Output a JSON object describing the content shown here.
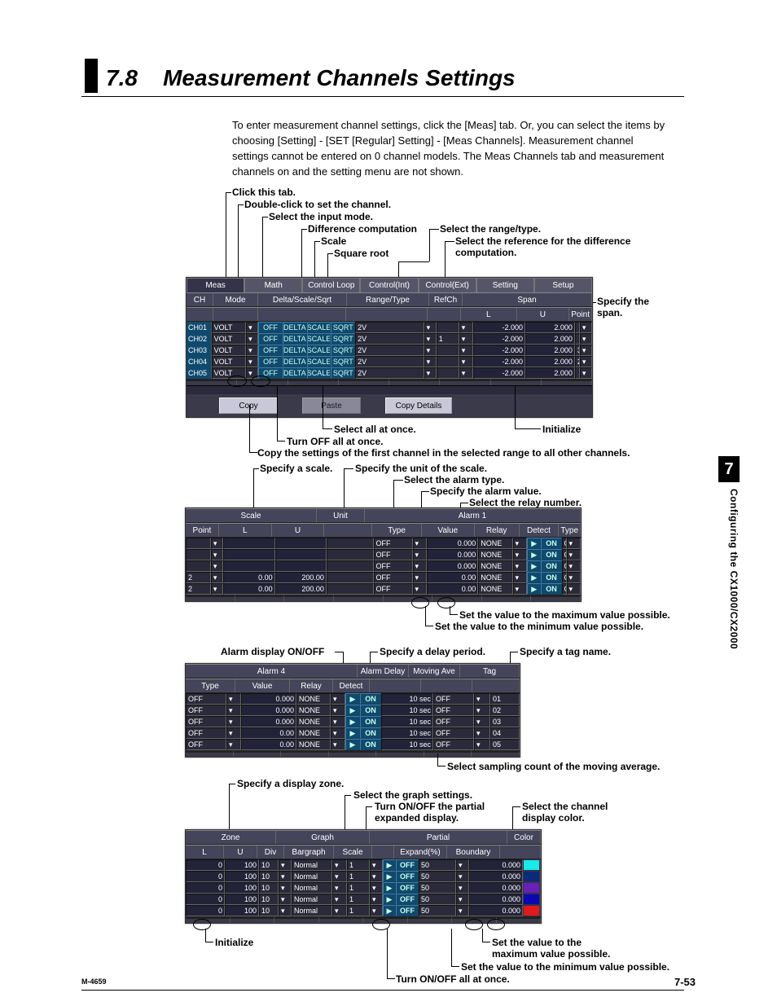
{
  "section_number": "7.8",
  "section_title": "Measurement Channels Settings",
  "intro": "To enter measurement channel settings, click the [Meas] tab.  Or, you can select the items by choosing [Setting] - [SET [Regular] Setting] - [Meas Channels].  Measurement channel settings cannot be entered on 0 channel models. The Meas Channels tab and measurement channels on and the setting menu are not shown.",
  "callouts": {
    "click_tab": "Click this tab.",
    "double_click": "Double-click to set the channel.",
    "input_mode": "Select the input mode.",
    "diff_comp": "Difference computation",
    "scale": "Scale",
    "sqrt": "Square root",
    "range_type": "Select the range/type.",
    "ref_diff": "Select the reference for the difference computation.",
    "specify_span": "Specify the span.",
    "select_all": "Select all at once.",
    "turn_off_all": "Turn OFF all at once.",
    "initialize": "Initialize",
    "copy_first": "Copy the settings of the first channel in the selected range to all other channels.",
    "specify_scale": "Specify a scale.",
    "specify_unit": "Specify the unit of the scale.",
    "alarm_type": "Select the alarm type.",
    "alarm_value": "Specify the alarm value.",
    "relay_number": "Select the relay number.",
    "set_max": "Set the value to the maximum value possible.",
    "set_min": "Set the value to the minimum value possible.",
    "alarm_display": "Alarm display ON/OFF",
    "delay_period": "Specify a delay period.",
    "tag_name": "Specify a tag name.",
    "moving_avg": "Select sampling count of the moving average.",
    "display_zone": "Specify a display zone.",
    "graph_settings": "Select the graph settings.",
    "partial_onoff": "Turn ON/OFF the partial expanded display.",
    "channel_color": "Select the channel display color.",
    "set_max2": "Set the value to the maximum value possible.",
    "set_min2": "Set the value to the minimum value possible.",
    "onoff_all": "Turn ON/OFF all at once.",
    "initialize2": "Initialize"
  },
  "shot1": {
    "tabs": [
      "Meas",
      "Math",
      "Control Loop",
      "Control(Int)",
      "Control(Ext)",
      "Setting",
      "Setup"
    ],
    "hdr_top": [
      "CH",
      "Mode",
      "Delta/Scale/Sqrt",
      "Range/Type",
      "RefCh",
      "Span"
    ],
    "hdr_span": [
      "L",
      "U",
      "Point"
    ],
    "rows": [
      {
        "ch": "CH01",
        "mode": "VOLT",
        "delta": "OFF",
        "d2": "DELTA",
        "d3": "SCALE",
        "d4": "SQRT",
        "range": "2V",
        "ref": "",
        "l": "-2.000",
        "u": "2.000",
        "pt": ""
      },
      {
        "ch": "CH02",
        "mode": "VOLT",
        "delta": "OFF",
        "d2": "DELTA",
        "d3": "SCALE",
        "d4": "SQRT",
        "range": "2V",
        "ref": "1",
        "l": "-2.000",
        "u": "2.000",
        "pt": ""
      },
      {
        "ch": "CH03",
        "mode": "VOLT",
        "delta": "OFF",
        "d2": "DELTA",
        "d3": "SCALE",
        "d4": "SQRT",
        "range": "2V",
        "ref": "",
        "l": "-2.000",
        "u": "2.000",
        "pt": "3"
      },
      {
        "ch": "CH04",
        "mode": "VOLT",
        "delta": "OFF",
        "d2": "DELTA",
        "d3": "SCALE",
        "d4": "SQRT",
        "range": "2V",
        "ref": "",
        "l": "-2.000",
        "u": "2.000",
        "pt": "2"
      },
      {
        "ch": "CH05",
        "mode": "VOLT",
        "delta": "OFF",
        "d2": "DELTA",
        "d3": "SCALE",
        "d4": "SQRT",
        "range": "2V",
        "ref": "",
        "l": "-2.000",
        "u": "2.000",
        "pt": ""
      }
    ],
    "buttons": [
      "Copy",
      "Paste",
      "Copy Details"
    ]
  },
  "shot2": {
    "hdr_groups": [
      "Scale",
      "Unit",
      "Alarm 1"
    ],
    "hdr": [
      "Point",
      "L",
      "U",
      "",
      "Type",
      "Value",
      "Relay",
      "Detect",
      "Type"
    ],
    "rows": [
      {
        "pt": "",
        "l": "",
        "u": "",
        "unit": "",
        "atype": "OFF",
        "val": "0.000",
        "relay": "NONE",
        "det": "ON",
        "t2": "OFF"
      },
      {
        "pt": "",
        "l": "",
        "u": "",
        "unit": "",
        "atype": "OFF",
        "val": "0.000",
        "relay": "NONE",
        "det": "ON",
        "t2": "OFF"
      },
      {
        "pt": "",
        "l": "",
        "u": "",
        "unit": "",
        "atype": "OFF",
        "val": "0.000",
        "relay": "NONE",
        "det": "ON",
        "t2": "OFF"
      },
      {
        "pt": "2",
        "l": "0.00",
        "u": "200.00",
        "unit": "",
        "atype": "OFF",
        "val": "0.00",
        "relay": "NONE",
        "det": "ON",
        "t2": "OFF"
      },
      {
        "pt": "2",
        "l": "0.00",
        "u": "200.00",
        "unit": "",
        "atype": "OFF",
        "val": "0.00",
        "relay": "NONE",
        "det": "ON",
        "t2": "OFF"
      }
    ]
  },
  "shot3": {
    "hdr_groups": [
      "Alarm 4",
      "Alarm Delay",
      "Moving Ave",
      "Tag"
    ],
    "hdr": [
      "Type",
      "Value",
      "Relay",
      "Detect",
      "",
      "",
      "",
      ""
    ],
    "rows": [
      {
        "type": "OFF",
        "val": "0.000",
        "relay": "NONE",
        "det": "ON",
        "delay": "10 sec",
        "mave": "OFF",
        "tag": "01"
      },
      {
        "type": "OFF",
        "val": "0.000",
        "relay": "NONE",
        "det": "ON",
        "delay": "10 sec",
        "mave": "OFF",
        "tag": "02"
      },
      {
        "type": "OFF",
        "val": "0.000",
        "relay": "NONE",
        "det": "ON",
        "delay": "10 sec",
        "mave": "OFF",
        "tag": "03"
      },
      {
        "type": "OFF",
        "val": "0.00",
        "relay": "NONE",
        "det": "ON",
        "delay": "10 sec",
        "mave": "OFF",
        "tag": "04"
      },
      {
        "type": "OFF",
        "val": "0.00",
        "relay": "NONE",
        "det": "ON",
        "delay": "10 sec",
        "mave": "OFF",
        "tag": "05"
      }
    ]
  },
  "shot4": {
    "hdr_groups": [
      "Zone",
      "Graph",
      "Partial",
      "Color"
    ],
    "hdr": [
      "L",
      "U",
      "Div",
      "Bargraph",
      "Scale",
      "",
      "Expand(%)",
      "Boundary",
      ""
    ],
    "rows": [
      {
        "l": "0",
        "u": "100",
        "div": "10",
        "bg": "Normal",
        "sc": "1",
        "on": "OFF",
        "exp": "50",
        "bnd": "0.000",
        "clr": "#18e9e9"
      },
      {
        "l": "0",
        "u": "100",
        "div": "10",
        "bg": "Normal",
        "sc": "1",
        "on": "OFF",
        "exp": "50",
        "bnd": "0.000",
        "clr": "#0a2a7a"
      },
      {
        "l": "0",
        "u": "100",
        "div": "10",
        "bg": "Normal",
        "sc": "1",
        "on": "OFF",
        "exp": "50",
        "bnd": "0.000",
        "clr": "#6a1fb8"
      },
      {
        "l": "0",
        "u": "100",
        "div": "10",
        "bg": "Normal",
        "sc": "1",
        "on": "OFF",
        "exp": "50",
        "bnd": "0.000",
        "clr": "#0808b0"
      },
      {
        "l": "0",
        "u": "100",
        "div": "10",
        "bg": "Normal",
        "sc": "1",
        "on": "OFF",
        "exp": "50",
        "bnd": "0.000",
        "clr": "#e01a1a"
      }
    ]
  },
  "side": {
    "chapter": "7",
    "label": "Configuring the CX1000/CX2000"
  },
  "footer": {
    "left": "M-4659",
    "right": "7-53"
  }
}
